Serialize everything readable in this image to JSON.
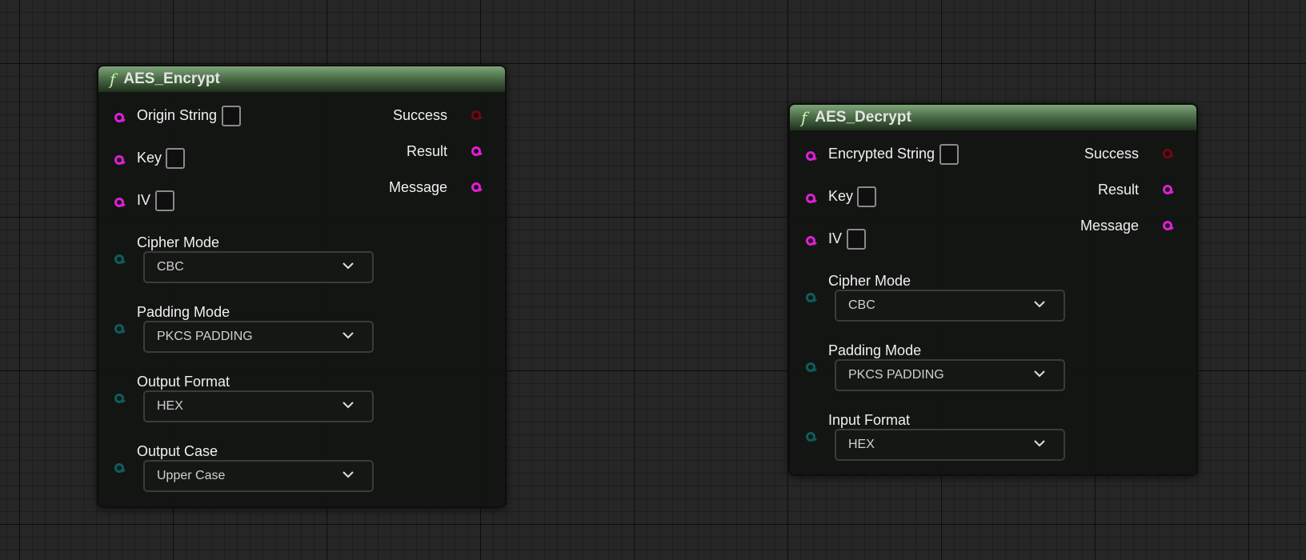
{
  "nodes": [
    {
      "title": "AES_Encrypt",
      "icon": "function-icon",
      "header_color": "#4d6f48",
      "inputs": [
        "Origin String",
        "Key",
        "IV"
      ],
      "outputs": [
        "Success",
        "Result",
        "Message"
      ],
      "options": [
        {
          "label": "Cipher Mode",
          "value": "CBC"
        },
        {
          "label": "Padding Mode",
          "value": "PKCS PADDING"
        },
        {
          "label": "Output Format",
          "value": "HEX"
        },
        {
          "label": "Output Case",
          "value": "Upper Case"
        }
      ]
    },
    {
      "title": "AES_Decrypt",
      "icon": "function-icon",
      "header_color": "#4d6f48",
      "inputs": [
        "Encrypted String",
        "Key",
        "IV"
      ],
      "outputs": [
        "Success",
        "Result",
        "Message"
      ],
      "options": [
        {
          "label": "Cipher Mode",
          "value": "CBC"
        },
        {
          "label": "Padding Mode",
          "value": "PKCS PADDING"
        },
        {
          "label": "Input Format",
          "value": "HEX"
        }
      ]
    }
  ],
  "colors": {
    "string_pin": "#e01ed6",
    "enum_pin": "#0b5e5c",
    "bool_pin": "#6a0a14",
    "canvas": "#262626"
  }
}
